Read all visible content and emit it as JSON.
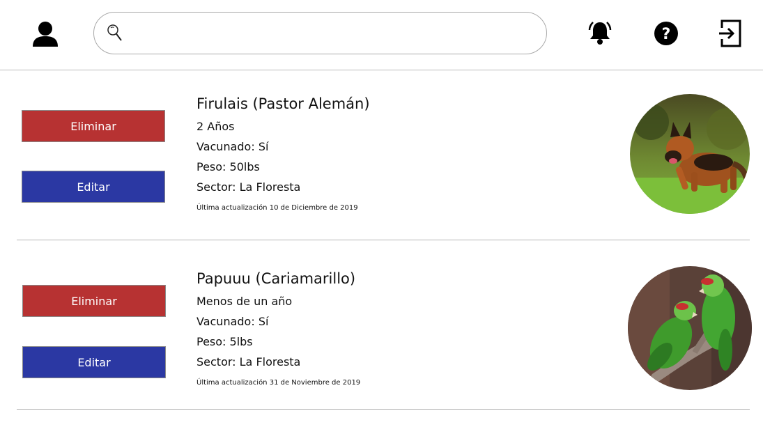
{
  "header": {
    "search_placeholder": "",
    "icons": [
      "user-icon",
      "search-icon",
      "bell-icon",
      "help-icon",
      "logout-icon"
    ]
  },
  "pets": [
    {
      "name": "Firulais (Pastor Alemán)",
      "age": "2 Años",
      "vaccinated": "Vacunado: Sí",
      "weight": "Peso: 50lbs",
      "sector": "Sector: La Floresta",
      "updated": "Última actualización 10 de Diciembre de 2019",
      "delete_label": "Eliminar",
      "edit_label": "Editar"
    },
    {
      "name": "Papuuu (Cariamarillo)",
      "age": "Menos de un año",
      "vaccinated": "Vacunado: Sí",
      "weight": "Peso: 5lbs",
      "sector": "Sector: La Floresta",
      "updated": "Última actualización 31 de Noviembre de 2019",
      "delete_label": "Eliminar",
      "edit_label": "Editar"
    }
  ],
  "colors": {
    "delete": "#b73232",
    "edit": "#2b38a3"
  }
}
